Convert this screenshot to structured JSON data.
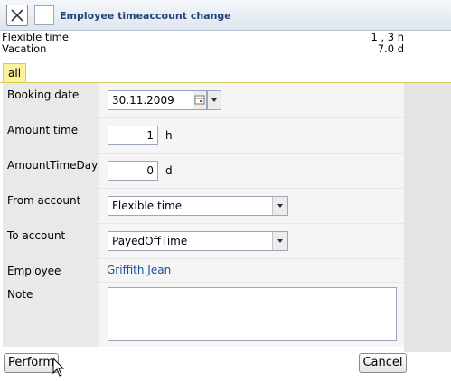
{
  "window": {
    "title": "Employee timeaccount change"
  },
  "summary": [
    {
      "label": "Flexible time",
      "value": "1 , 3 h"
    },
    {
      "label": "Vacation",
      "value": "7.0 d"
    }
  ],
  "tabs": [
    {
      "label": "all"
    }
  ],
  "form": {
    "booking_date": {
      "label": "Booking date",
      "value": "30.11.2009"
    },
    "amount_time": {
      "label": "Amount time",
      "value": "1",
      "unit": "h"
    },
    "amount_time_days": {
      "label": "AmountTimeDays",
      "value": "0",
      "unit": "d"
    },
    "from_account": {
      "label": "From account",
      "selected": "Flexible time"
    },
    "to_account": {
      "label": "To account",
      "selected": "PayedOffTime"
    },
    "employee": {
      "label": "Employee",
      "value": "Griffith Jean"
    },
    "note": {
      "label": "Note",
      "value": ""
    }
  },
  "buttons": {
    "perform": "Perform",
    "cancel": "Cancel"
  },
  "colors": {
    "tab_background": "#fbf29a",
    "link": "#1c4fa0",
    "title": "#23427a"
  }
}
